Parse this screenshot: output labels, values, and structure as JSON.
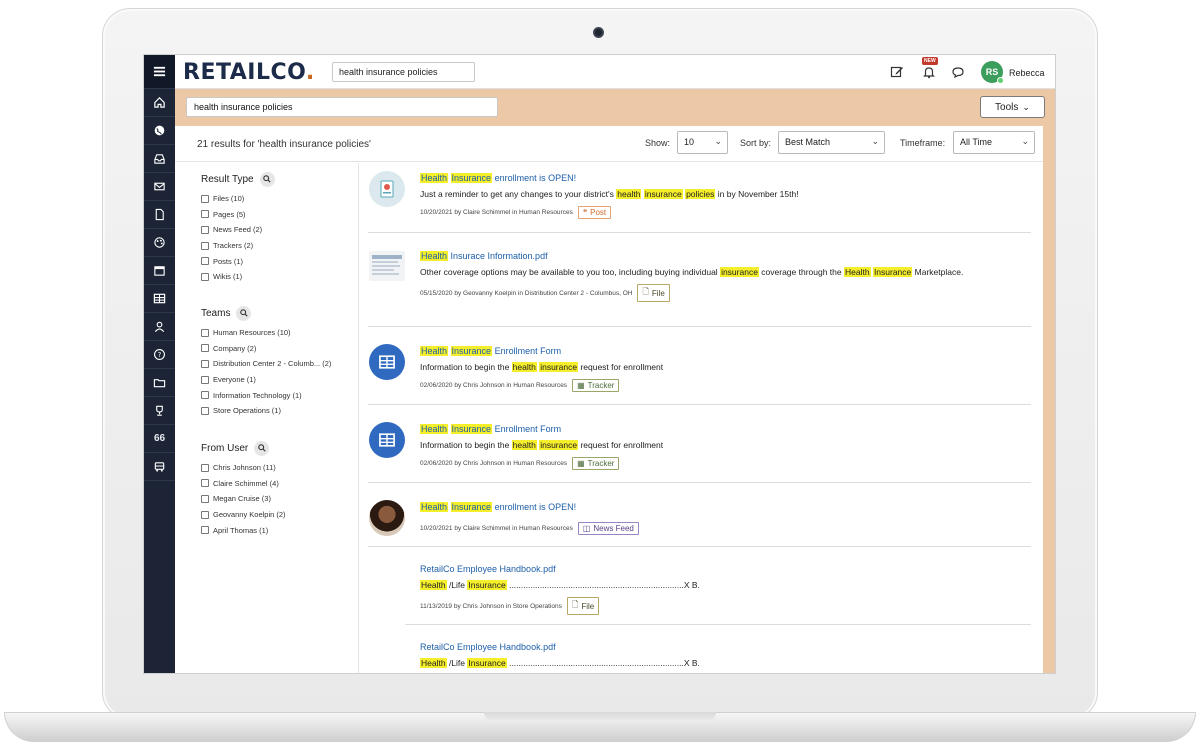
{
  "app": {
    "logo": "RETAILCO",
    "logo_dot": ".",
    "top_search_value": "health insurance policies",
    "badge_new": "NEW",
    "avatar_initials": "RS",
    "username": "Rebecca"
  },
  "rail": {
    "icons": [
      "menu-icon",
      "home-icon",
      "globe-icon",
      "inbox-icon",
      "mail-icon",
      "document-icon",
      "palette-icon",
      "calendar-icon",
      "table-icon",
      "person-icon",
      "help-icon",
      "folders-icon",
      "trophy-icon",
      "quote-icon",
      "bus-icon"
    ],
    "quote_glyph": "66"
  },
  "search": {
    "value": "health insurance policies",
    "tools_label": "Tools"
  },
  "results_bar": {
    "count_text": "21 results for 'health insurance policies'",
    "show_label": "Show:",
    "show_value": "10",
    "sort_label": "Sort by:",
    "sort_value": "Best Match",
    "timeframe_label": "Timeframe:",
    "timeframe_value": "All Time"
  },
  "filters": {
    "result_type": {
      "title": "Result Type",
      "items": [
        "Files (10)",
        "Pages (5)",
        "News Feed (2)",
        "Trackers (2)",
        "Posts (1)",
        "Wikis (1)"
      ]
    },
    "teams": {
      "title": "Teams",
      "items": [
        "Human Resources (10)",
        "Company (2)",
        "Distribution Center 2 - Columb... (2)",
        "Everyone (1)",
        "Information Technology (1)",
        "Store Operations (1)"
      ]
    },
    "from_user": {
      "title": "From User",
      "items": [
        "Chris Johnson (11)",
        "Claire Schimmel (4)",
        "Megan Cruise (3)",
        "Geovanny Koelpin (2)",
        "April Thomas (1)"
      ]
    }
  },
  "results": [
    {
      "title_parts": [
        "Health",
        " ",
        "Insurance",
        " enrollment is OPEN!"
      ],
      "text_parts": [
        "Just a reminder to get any changes to your district's ",
        "health",
        " ",
        "insurance",
        " ",
        "policies",
        " in by November 15th!"
      ],
      "meta": "10/20/2021 by Claire Schimmel in Human Resources",
      "tag": "Post"
    },
    {
      "title_parts": [
        "Health",
        " Insurace Information.pdf"
      ],
      "text_parts": [
        "Other coverage options may be available to you too, including buying individual ",
        "insurance",
        " coverage through the ",
        "Health",
        " ",
        "Insurance",
        " Marketplace."
      ],
      "meta": "05/15/2020 by Geovanny Koelpin in Distribution Center 2 - Columbus, OH",
      "tag": "File"
    },
    {
      "title_parts": [
        "Health",
        " ",
        "Insurance",
        " Enrollment Form"
      ],
      "text_parts": [
        "Information to begin the ",
        "health",
        " ",
        "insurance",
        " request for enrollment"
      ],
      "meta": "02/06/2020 by Chris Johnson in Human Resources",
      "tag": "Tracker"
    },
    {
      "title_parts": [
        "Health",
        " ",
        "Insurance",
        " Enrollment Form"
      ],
      "text_parts": [
        "Information to begin the ",
        "health",
        " ",
        "insurance",
        " request for enrollment"
      ],
      "meta": "02/06/2020 by Chris Johnson in Human Resources",
      "tag": "Tracker"
    },
    {
      "title_parts": [
        "Health",
        " ",
        "Insurance",
        " enrollment is OPEN!"
      ],
      "meta": "10/20/2021 by Claire Schimmel in Human Resources",
      "tag": "News Feed"
    },
    {
      "title": "RetailCo Employee Handbook.pdf",
      "text_parts": [
        "Health",
        " /Life ",
        "Insurance",
        " ..........................................................................X  B."
      ],
      "meta": "11/13/2019 by Chris Johnson in Store Operations",
      "tag": "File"
    },
    {
      "title": "RetailCo Employee Handbook.pdf",
      "text_parts": [
        "Health",
        " /Life ",
        "Insurance",
        " ..........................................................................X  B."
      ]
    }
  ],
  "colors": {
    "rail": "#1c2436",
    "band": "#ecc8a6",
    "link": "#1d5fa8",
    "highlight": "#f5ee2a"
  }
}
